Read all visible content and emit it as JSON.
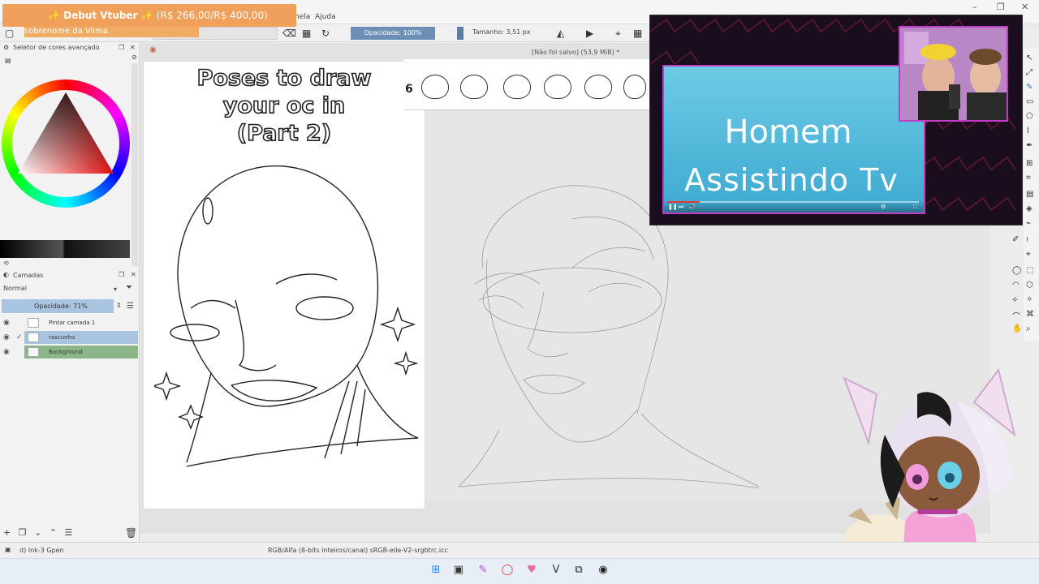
{
  "banner": {
    "title": "✨ Debut Vtuber ✨",
    "amount": "(R$ 266,00/R$ 400,00)",
    "progress": 0.665,
    "subtitle": "sobrenome da Vilma"
  },
  "menu": {
    "items": [
      "nela",
      "Ajuda"
    ]
  },
  "toolbar": {
    "blend_mode": "Normal",
    "opacity": "Opacidade: 100%",
    "size": "Tamanho: 3,51 px"
  },
  "document": {
    "status": "[Não foi salvo]  (53,9 MiB) *"
  },
  "color_panel": {
    "title": "Seletor de cores avançado"
  },
  "layers_panel": {
    "title": "Camadas",
    "blend_mode": "Normal",
    "opacity": "Opacidade:  71%",
    "layers": [
      {
        "name": "Pintar camada 1",
        "selected": false
      },
      {
        "name": "rascunho",
        "selected": true
      },
      {
        "name": "Background",
        "selected": false
      }
    ]
  },
  "reference": {
    "title_lines": [
      "Poses to draw",
      "your oc in",
      "(Part 2)"
    ],
    "sticker_number": "6"
  },
  "stream": {
    "tv_line1": "Homem",
    "tv_line2": "Assistindo Tv",
    "video_progress": 0.13
  },
  "statusbar": {
    "brush": "d) Ink-3 Gpen",
    "color_info": "RGB/Alfa (8-bits inteiros/canal)  sRGB-elle-V2-srgbtrc.icc"
  },
  "colors": {
    "accent_magenta": "#c13ec4",
    "banner_orange": "#f0a05a",
    "selection_blue": "#a9c4e0"
  }
}
